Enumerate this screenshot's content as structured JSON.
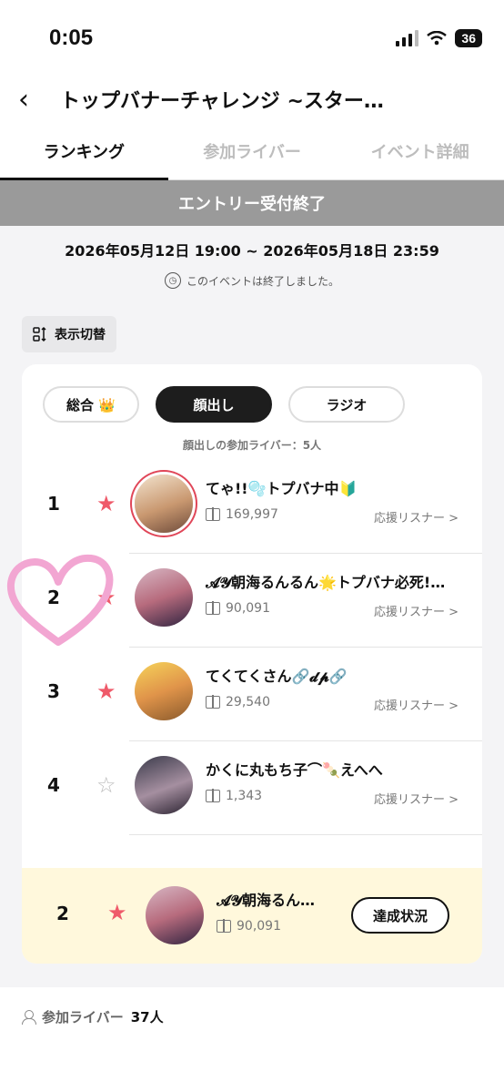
{
  "status": {
    "time": "0:05",
    "battery": "36"
  },
  "header": {
    "back": "‹",
    "title": "トップバナーチャレンジ ~スター…"
  },
  "tabs": [
    {
      "label": "ランキング",
      "active": true
    },
    {
      "label": "参加ライバー",
      "active": false
    },
    {
      "label": "イベント詳細",
      "active": false
    }
  ],
  "banner": "エントリー受付終了",
  "period": "2026年05月12日 19:00 ~ 2026年05月18日 23:59",
  "ended": "このイベントは終了しました。",
  "toggle": {
    "label": "表示切替",
    "icon": "sort-icon"
  },
  "filters": [
    {
      "label": "総合 👑",
      "active": false
    },
    {
      "label": "顔出し",
      "active": true
    },
    {
      "label": "ラジオ",
      "active": false
    }
  ],
  "count_text": "顔出しの参加ライバー：5人",
  "rankings": [
    {
      "rank": "1",
      "starred": true,
      "name": "てゃ!!🫧トプバナ中🔰",
      "points": "169,997",
      "listeners": "応援リスナー >"
    },
    {
      "rank": "2",
      "starred": true,
      "name": "𝓐𝓨朝海るんるん🌟トプバナ必死!…",
      "points": "90,091",
      "listeners": "応援リスナー >"
    },
    {
      "rank": "3",
      "starred": true,
      "name": "てくてくさん🔗𝓭𝓹🔗",
      "points": "29,540",
      "listeners": "応援リスナー >"
    },
    {
      "rank": "4",
      "starred": false,
      "name": "かくに丸もち子⌒🍡えへへ",
      "points": "1,343",
      "listeners": "応援リスナー >"
    }
  ],
  "mine": {
    "rank": "2",
    "name": "𝓐𝓨朝海るん…",
    "points": "90,091",
    "button": "達成状況"
  },
  "footer": {
    "label": "参加ライバー",
    "value": "37人"
  },
  "colors": {
    "star": "#ef5a6a",
    "banner": "#9a9a9a",
    "mine_bg": "#fff8dc",
    "heart": "#f2a6d2"
  }
}
